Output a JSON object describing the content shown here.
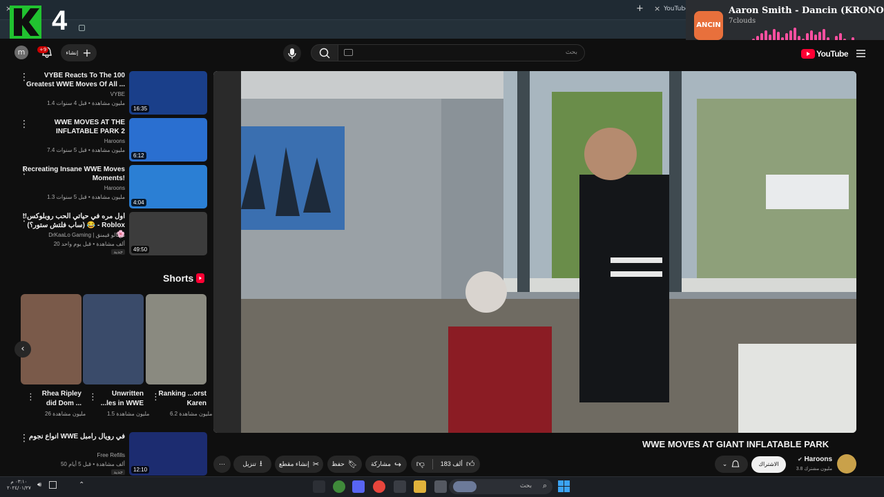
{
  "browser": {
    "tab_label": "YouTube",
    "close_glyph": "×",
    "new_tab_glyph": "+"
  },
  "channel_logo": {
    "letter": "K",
    "number": "4"
  },
  "notification": {
    "title": "Aaron Smith - Dancin (KRONO Re...",
    "subtitle": "7clouds",
    "art_text": "ANCIN"
  },
  "yt_header": {
    "avatar_letter": "m",
    "notif_count": "+9",
    "create_label": "إنشاء",
    "search_placeholder": "بحث",
    "brand": "YouTube"
  },
  "recommendations": [
    {
      "title": "VYBE Reacts To The 100 Greatest WWE Moves Of All ...",
      "channel": "VYBE",
      "meta": "1.4 مليون مشاهدة • قبل 4 سنوات",
      "duration": "16:35",
      "thumb_color": "#1a3f8a",
      "badge": ""
    },
    {
      "title": "WWE MOVES AT THE INFLATABLE PARK 2",
      "channel": "Haroons",
      "meta": "7.4 مليون مشاهدة • قبل 5 سنوات",
      "duration": "6:12",
      "thumb_color": "#2a6fd0",
      "badge": ""
    },
    {
      "title": "Recreating Insane WWE Moves Moments!",
      "channel": "Haroons",
      "meta": "1.3 مليون مشاهدة • قبل 5 سنوات",
      "duration": "4:04",
      "thumb_color": "#2b7fd4",
      "badge": ""
    },
    {
      "title": "اول مره في حياتي الحب روبلوكس!! 😂 (ساب فلتش ستور؟) - Roblox 🌸",
      "channel": "DrKaaLo Gaming | دركالو قيمنق",
      "meta": "20 ألف مشاهدة • قبل يوم واحد",
      "duration": "49:50",
      "thumb_color": "#3c3c3c",
      "badge": "جديد"
    },
    {
      "title": "انواع نجوم WWE في رويال رامبل",
      "channel": "Free Refills",
      "meta": "50 ألف مشاهدة • قبل 5 أيام",
      "duration": "12:10",
      "thumb_color": "#1c2c70",
      "badge": "جديد"
    }
  ],
  "shorts": {
    "section_title": "Shorts",
    "items": [
      {
        "title": "Rhea Ripley did Dom ...",
        "views": "26 مليون مشاهدة",
        "color": "#7a5a4a"
      },
      {
        "title": "Unwritten ...les in WWE",
        "views": "1.5 مليون مشاهدة",
        "color": "#3a4b6a"
      },
      {
        "title": "Ranking ...orst Karen",
        "views": "6.2 مليون مشاهدة",
        "color": "#8a8a80"
      }
    ]
  },
  "video": {
    "title": "WWE MOVES AT GIANT INFLATABLE PARK",
    "channel": "Haroons",
    "subscribers": "3.8 مليون مشترك",
    "subscribe_label": "الاشتراك",
    "likes": "183 ألف",
    "share_label": "مشاركة",
    "save_label": "حفظ",
    "clip_label": "إنشاء مقطع",
    "download_label": "تنزيل"
  },
  "taskbar": {
    "search_placeholder": "بحث",
    "time": "٠٣:١٠ م",
    "date": "٢٠٢٤/٠١/٢٧"
  },
  "colors": {
    "youtube_red": "#ff0033",
    "background": "#0f0f0f",
    "notif_eq": "#ff4fa0"
  }
}
